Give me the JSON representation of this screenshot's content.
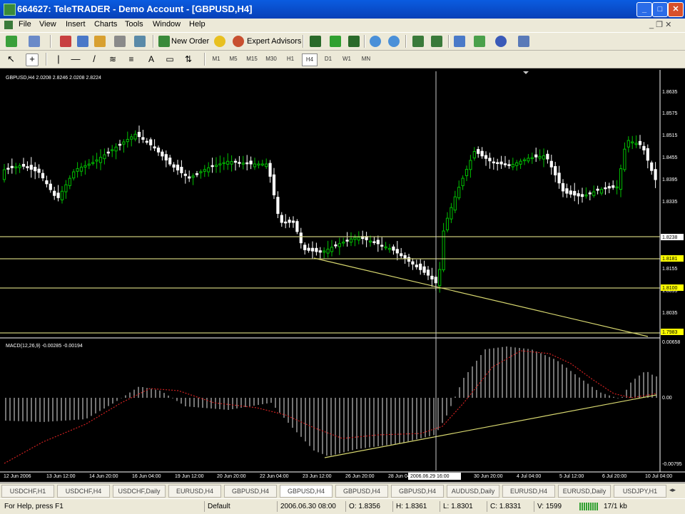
{
  "window": {
    "title": "664627: TeleTRADER - Demo Account - [GBPUSD,H4]",
    "min": "_",
    "max": "□",
    "close": "✕"
  },
  "menu": {
    "items": [
      "File",
      "View",
      "Insert",
      "Charts",
      "Tools",
      "Window",
      "Help"
    ],
    "mdi_controls": "_ ❐ ✕"
  },
  "toolbar": {
    "new_order": "New Order",
    "expert_advisors": "Expert Advisors"
  },
  "timeframes": {
    "items": [
      "M1",
      "M5",
      "M15",
      "M30",
      "H1",
      "H4",
      "D1",
      "W1",
      "MN"
    ],
    "active": "H4"
  },
  "chart": {
    "header": "GBPUSD,H4  2.0208 2.8246 2.0208 2.8224",
    "price_ticks": [
      "1.8635",
      "1.8575",
      "1.8515",
      "1.8455",
      "1.8395",
      "1.8335",
      "1.8155",
      "1.8095",
      "1.8035"
    ],
    "price_labels": [
      "1.8238",
      "1.8181",
      "1.8100",
      "1.7983"
    ],
    "macd_header": "MACD(12,26,9) -0.00285 -0.00194",
    "macd_ticks": [
      "0.00658",
      "0.00",
      "-0.00795"
    ],
    "dates": [
      "12 Jun 2006",
      "13 Jun 12:00",
      "14 Jun 20:00",
      "16 Jun 04:00",
      "19 Jun 12:00",
      "20 Jun 20:00",
      "22 Jun 04:00",
      "23 Jun 12:00",
      "26 Jun 20:00",
      "28 Jun 04:00",
      "30 Jun 20:00",
      "4 Jul 04:00",
      "5 Jul 12:00",
      "6 Jul 20:00",
      "10 Jul 04:00"
    ],
    "crosshair_date": "2006.06.29 16:00",
    "colors": {
      "bull": "#00c000",
      "bear": "#ffffff",
      "hline": "#c8c878",
      "trend": "#d8d870",
      "macd_signal": "#d02020",
      "label_bg": "#ffff00"
    }
  },
  "tabs": [
    "USDCHF,H1",
    "USDCHF,H4",
    "USDCHF,Daily",
    "EURUSD,H4",
    "GBPUSD,H4",
    "GBPUSD,H4",
    "GBPUSD,H4",
    "GBPUSD,H4",
    "AUDUSD,Daily",
    "EURUSD,H4",
    "EURUSD,Daily",
    "USDJPY,H1"
  ],
  "status": {
    "help": "For Help, press F1",
    "profile": "Default",
    "datetime": "2006.06.30 08:00",
    "open": "O: 1.8356",
    "high": "H: 1.8361",
    "low": "L: 1.8301",
    "close": "C: 1.8331",
    "volume": "V: 1599",
    "traffic": "17/1 kb"
  }
}
